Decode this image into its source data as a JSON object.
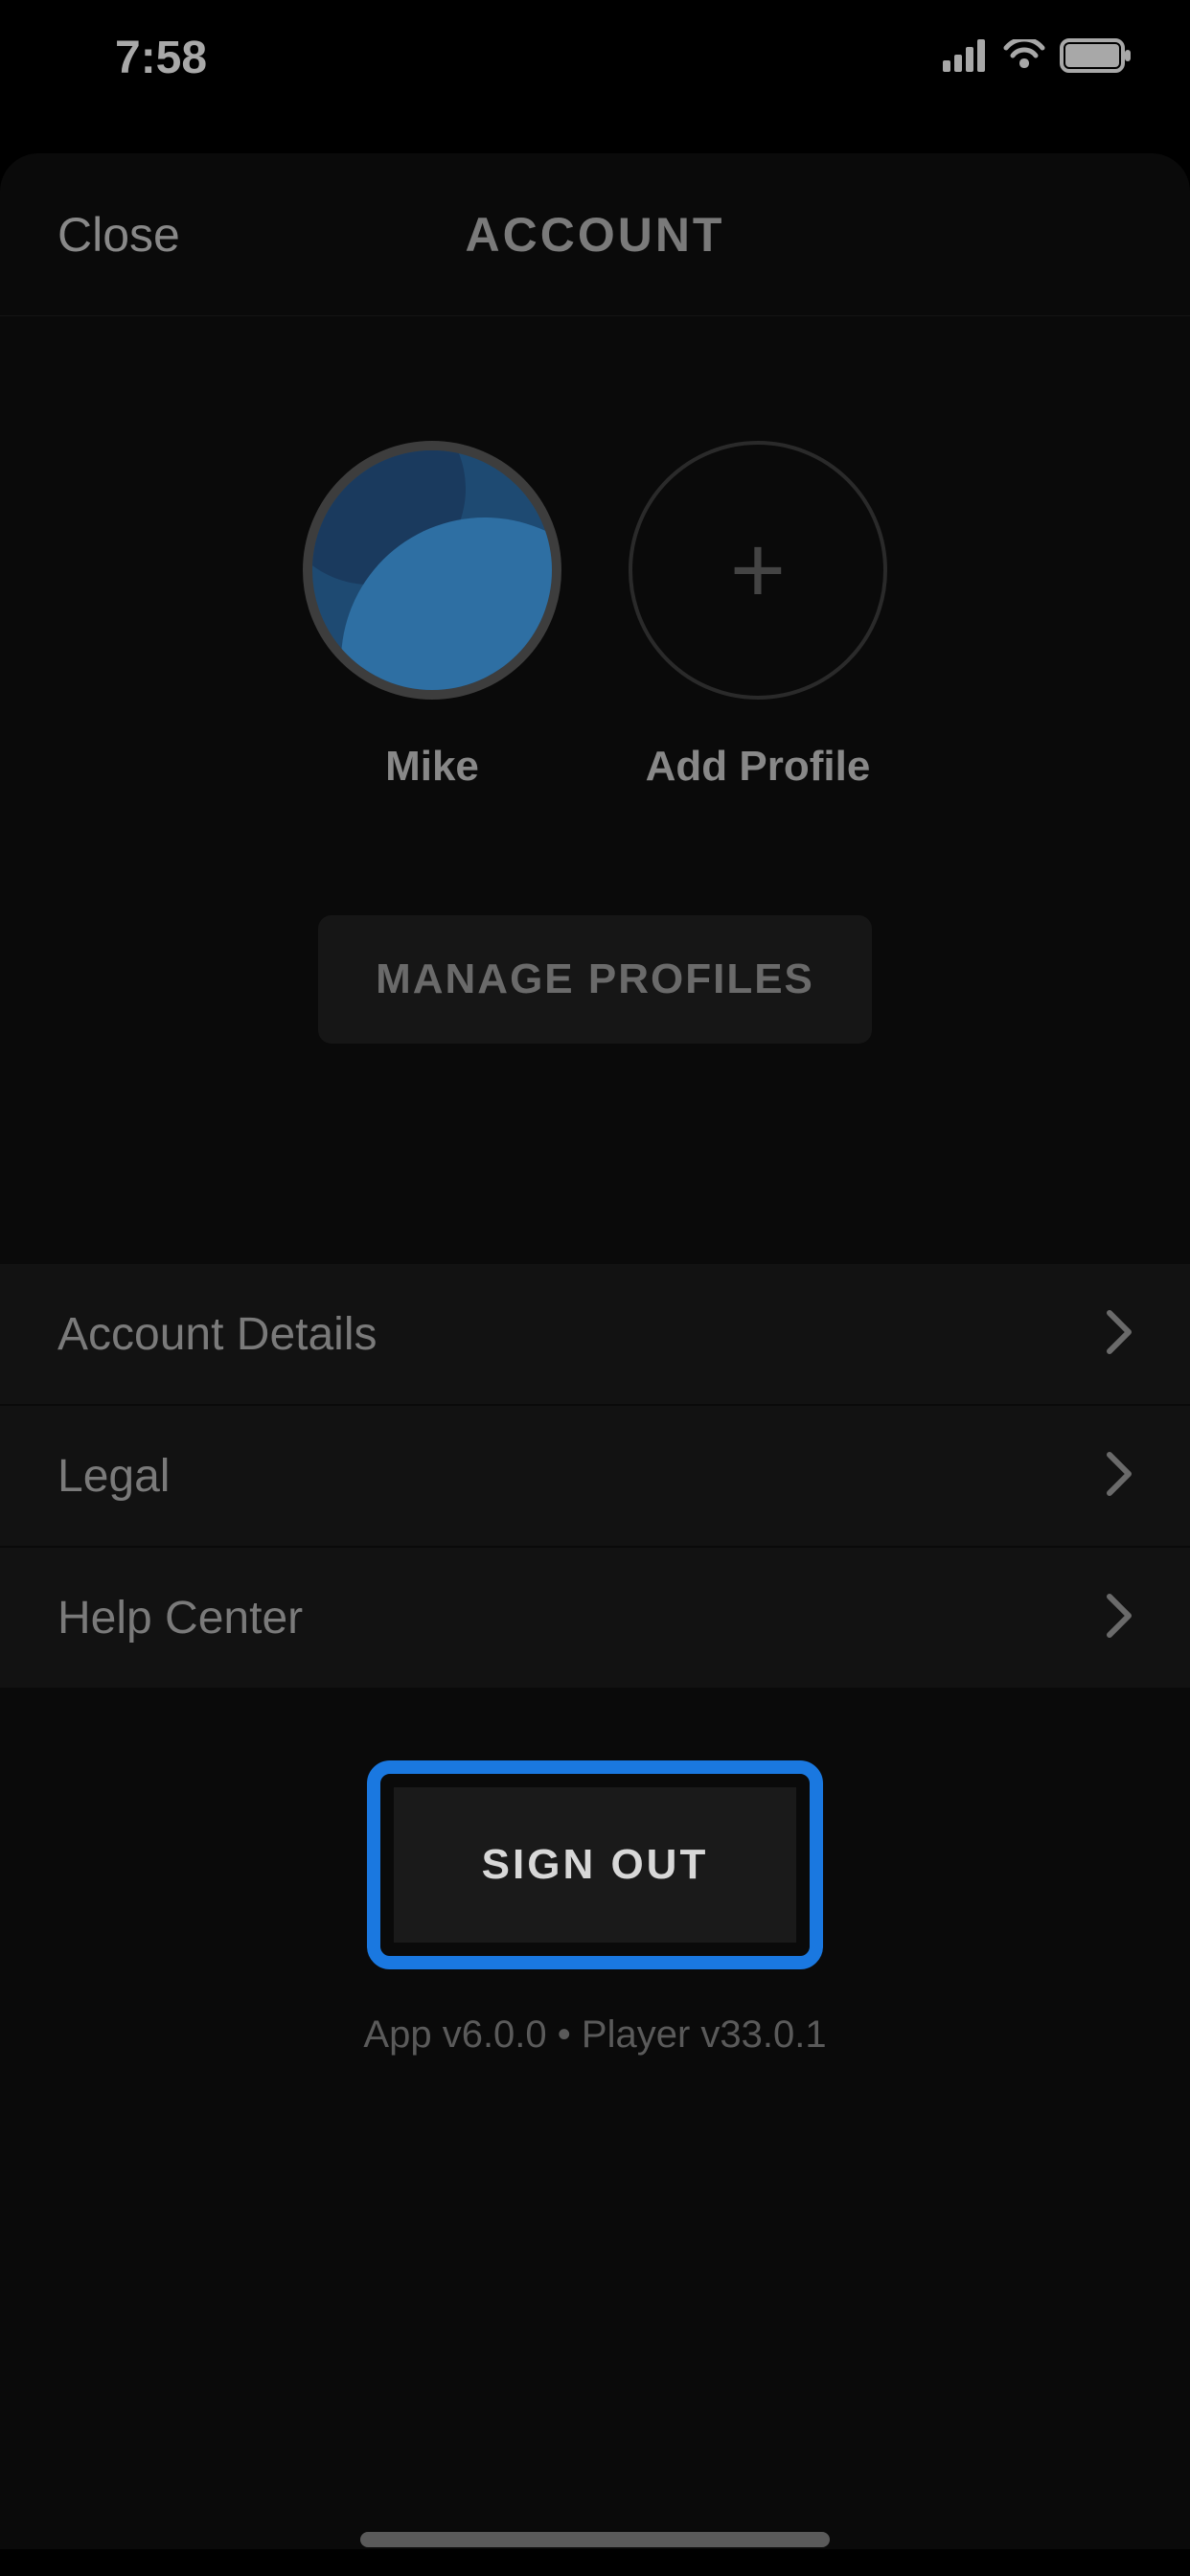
{
  "status_bar": {
    "time": "7:58"
  },
  "nav": {
    "close_label": "Close",
    "title": "ACCOUNT"
  },
  "profiles": {
    "items": [
      {
        "label": "Mike"
      },
      {
        "label": "Add Profile"
      }
    ],
    "manage_label": "MANAGE PROFILES"
  },
  "menu": {
    "items": [
      {
        "label": "Account Details"
      },
      {
        "label": "Legal"
      },
      {
        "label": "Help Center"
      }
    ]
  },
  "signout_label": "SIGN OUT",
  "version_text": "App v6.0.0 • Player v33.0.1"
}
